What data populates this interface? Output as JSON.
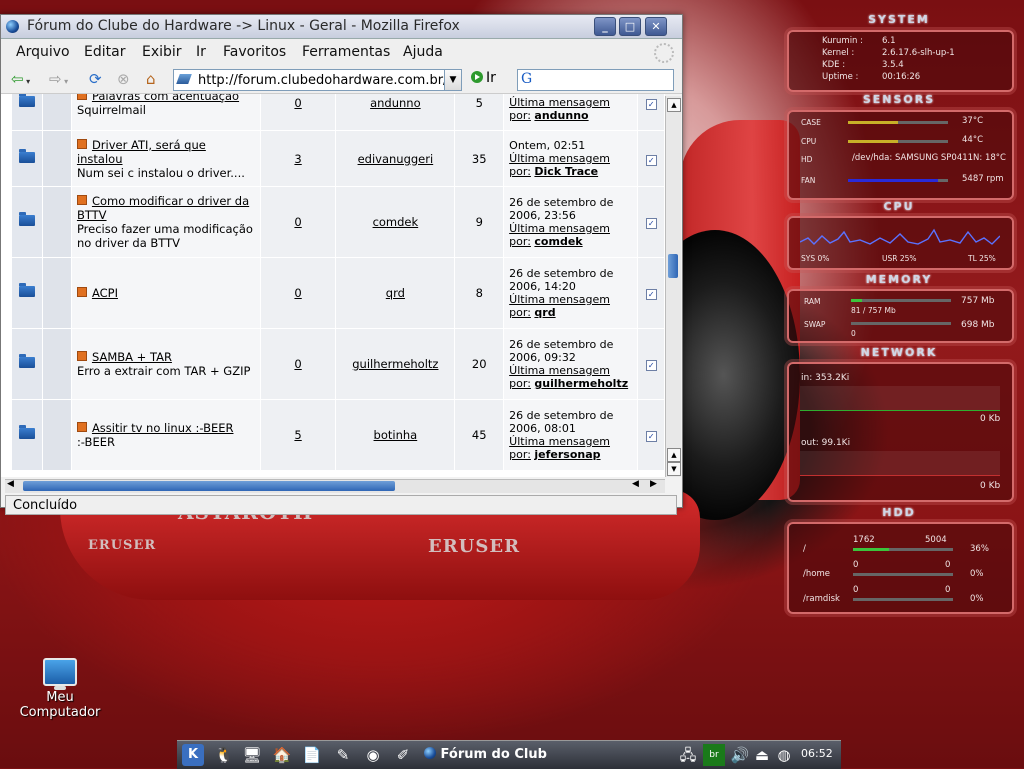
{
  "colors": {
    "accent": "#2f66b5",
    "orange_tag": "#e07020",
    "desktop_red": "#931a1c"
  },
  "window": {
    "title": "Fórum do Clube do Hardware -> Linux - Geral - Mozilla Firefox",
    "buttons": [
      "minimize-icon",
      "maximize-icon",
      "close-icon"
    ]
  },
  "menu": [
    "Arquivo",
    "Editar",
    "Exibir",
    "Ir",
    "Favoritos",
    "Ferramentas",
    "Ajuda"
  ],
  "navbar": {
    "url": "http://forum.clubedohardware.com.br/i",
    "go_label": "Ir",
    "search_engine_letter": "G"
  },
  "topics": [
    {
      "title": "Palavras com acentuação",
      "desc": "Squirrelmail",
      "replies": "0",
      "author": "andunno",
      "views": "5",
      "last_date": "",
      "last_label": "Última mensagem",
      "last_by": "por:",
      "last_user": "andunno"
    },
    {
      "title": "Driver ATI, será que instalou",
      "desc": "Num sei c instalou o driver....",
      "replies": "3",
      "author": "edivanuggeri",
      "views": "35",
      "last_date": "Ontem, 02:51",
      "last_label": "Última mensagem",
      "last_by": "por:",
      "last_user": "Dick Trace"
    },
    {
      "title": "Como modificar o driver da BTTV",
      "desc": "Preciso fazer uma modificação no driver da BTTV",
      "replies": "0",
      "author": "comdek",
      "views": "9",
      "last_date": "26 de setembro de 2006, 23:56",
      "last_label": "Última mensagem",
      "last_by": "por:",
      "last_user": "comdek"
    },
    {
      "title": "ACPI",
      "desc": "",
      "replies": "0",
      "author": "qrd",
      "views": "8",
      "last_date": "26 de setembro de 2006, 14:20",
      "last_label": "Última mensagem",
      "last_by": "por:",
      "last_user": "qrd"
    },
    {
      "title": "SAMBA + TAR",
      "desc": "Erro a extrair com TAR + GZIP",
      "replies": "0",
      "author": "guilhermeholtz",
      "views": "20",
      "last_date": "26 de setembro de 2006, 09:32",
      "last_label": "Última mensagem",
      "last_by": "por:",
      "last_user": "guilhermeholtz"
    },
    {
      "title": "Assitir tv no linux :-BEER",
      "desc": ":-BEER",
      "replies": "5",
      "author": "botinha",
      "views": "45",
      "last_date": "26 de setembro de 2006, 08:01",
      "last_label": "Última mensagem",
      "last_by": "por:",
      "last_user": "jefersonap"
    }
  ],
  "status": "Concluído",
  "desktop": {
    "icon_label_1": "Meu",
    "icon_label_2": "Computador"
  },
  "car_text": {
    "brand": "ASTAROTH",
    "model_1": "ERUSER",
    "model_2": "ERUSER"
  },
  "monitor": {
    "system": {
      "title": "SYSTEM",
      "rows": [
        {
          "k": "Kurumin :",
          "v": "6.1"
        },
        {
          "k": "Kernel :",
          "v": "2.6.17.6-slh-up-1"
        },
        {
          "k": "KDE :",
          "v": "3.5.4"
        },
        {
          "k": "Uptime :",
          "v": "00:16:26"
        }
      ]
    },
    "sensors": {
      "title": "SENSORS",
      "rows": [
        {
          "k": "CASE",
          "v": "37°C"
        },
        {
          "k": "CPU",
          "v": "44°C"
        },
        {
          "k": "HD",
          "v": "/dev/hda: SAMSUNG SP0411N: 18°C"
        },
        {
          "k": "FAN",
          "v": "5487 rpm"
        }
      ]
    },
    "cpu": {
      "title": "CPU",
      "sys": "SYS 0%",
      "usr": "USR 25%",
      "tl": "TL 25%"
    },
    "memory": {
      "title": "MEMORY",
      "ram_label": "RAM",
      "ram_value": "757 Mb",
      "ram_used": "81 / 757 Mb",
      "ram_fraction": 0.11,
      "swap_label": "SWAP",
      "swap_value": "698 Mb",
      "swap_used": "0",
      "swap_fraction": 0
    },
    "network": {
      "title": "NETWORK",
      "in": "in: 353.2Ki",
      "in_rate": "0 Kb",
      "out": "out: 99.1Ki",
      "out_rate": "0 Kb"
    },
    "hdd": {
      "title": "HDD",
      "rows": [
        {
          "mount": "/",
          "used": "1762",
          "total": "5004",
          "pct": "36%",
          "fraction": 0.36
        },
        {
          "mount": "/home",
          "used": "0",
          "total": "0",
          "pct": "0%",
          "fraction": 0
        },
        {
          "mount": "/ramdisk",
          "used": "0",
          "total": "0",
          "pct": "0%",
          "fraction": 0
        }
      ]
    }
  },
  "taskbar": {
    "task_title": "Fórum do Club",
    "clock": "06:52"
  }
}
